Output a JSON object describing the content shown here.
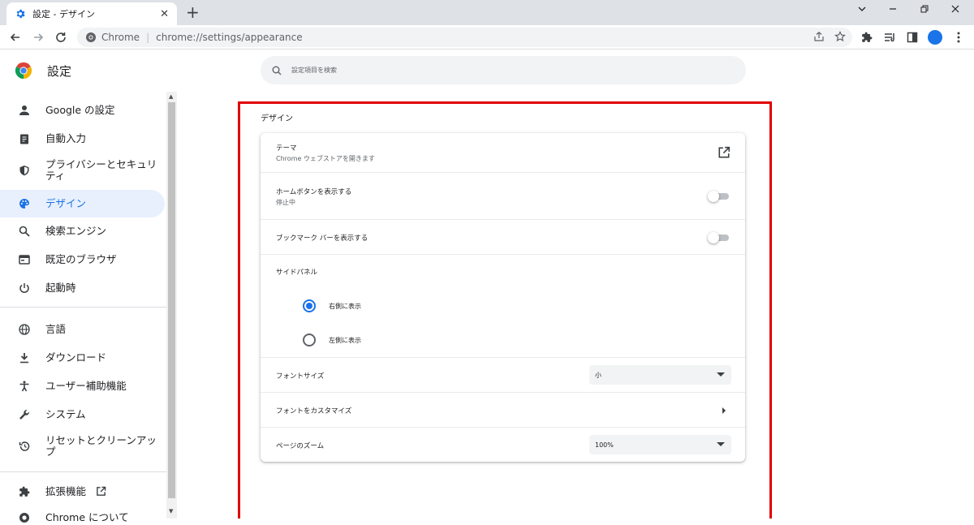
{
  "browser": {
    "tab_title": "設定 - デザイン",
    "tab_close": "✕",
    "new_tab": "+",
    "omnibox_site": "Chrome",
    "omnibox_sep": "|",
    "omnibox_url": "chrome://settings/appearance"
  },
  "header": {
    "title": "設定",
    "search_placeholder": "設定項目を検索"
  },
  "sidebar": {
    "items": [
      {
        "label": "Google の設定",
        "icon": "person-icon"
      },
      {
        "label": "自動入力",
        "icon": "clipboard-icon"
      },
      {
        "label": "プライバシーとセキュリティ",
        "icon": "shield-icon"
      },
      {
        "label": "デザイン",
        "icon": "palette-icon",
        "active": true
      },
      {
        "label": "検索エンジン",
        "icon": "search-icon"
      },
      {
        "label": "既定のブラウザ",
        "icon": "browser-icon"
      },
      {
        "label": "起動時",
        "icon": "power-icon"
      },
      {
        "label": "言語",
        "icon": "globe-icon"
      },
      {
        "label": "ダウンロード",
        "icon": "download-icon"
      },
      {
        "label": "ユーザー補助機能",
        "icon": "accessibility-icon"
      },
      {
        "label": "システム",
        "icon": "wrench-icon"
      },
      {
        "label": "リセットとクリーンアップ",
        "icon": "restore-icon"
      },
      {
        "label": "拡張機能",
        "icon": "puzzle-icon"
      },
      {
        "label": "Chrome について",
        "icon": "chrome-icon"
      }
    ]
  },
  "main": {
    "section_title": "デザイン",
    "theme_label": "テーマ",
    "theme_sub": "Chrome ウェブストアを開きます",
    "home_button_label": "ホームボタンを表示する",
    "home_button_sub": "停止中",
    "bookmarks_bar_label": "ブックマーク バーを表示する",
    "side_panel_label": "サイドパネル",
    "side_panel_options": [
      "右側に表示",
      "左側に表示"
    ],
    "font_size_label": "フォントサイズ",
    "font_size_value": "小",
    "customize_fonts_label": "フォントをカスタマイズ",
    "page_zoom_label": "ページのズーム",
    "page_zoom_value": "100%"
  },
  "colors": {
    "accent": "#1a73e8",
    "highlight_box": "#e00000"
  }
}
